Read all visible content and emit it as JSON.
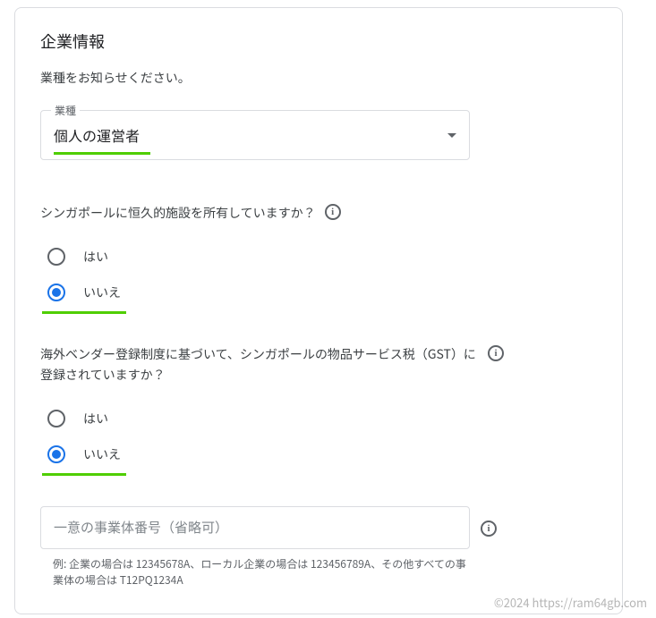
{
  "section": {
    "title": "企業情報",
    "prompt": "業種をお知らせください。"
  },
  "select": {
    "label": "業種",
    "value": "個人の運営者"
  },
  "question1": {
    "text": "シンガポールに恒久的施設を所有していますか？",
    "options": {
      "yes": "はい",
      "no": "いいえ"
    }
  },
  "question2": {
    "text": "海外ベンダー登録制度に基づいて、シンガポールの物品サービス税（GST）に登録されていますか？",
    "options": {
      "yes": "はい",
      "no": "いいえ"
    }
  },
  "entity_input": {
    "placeholder": "一意の事業体番号（省略可）",
    "helper": "例: 企業の場合は 12345678A、ローカル企業の場合は 123456789A、その他すべての事業体の場合は T12PQ1234A"
  },
  "watermark": "©2024 https://ram64gb.com"
}
